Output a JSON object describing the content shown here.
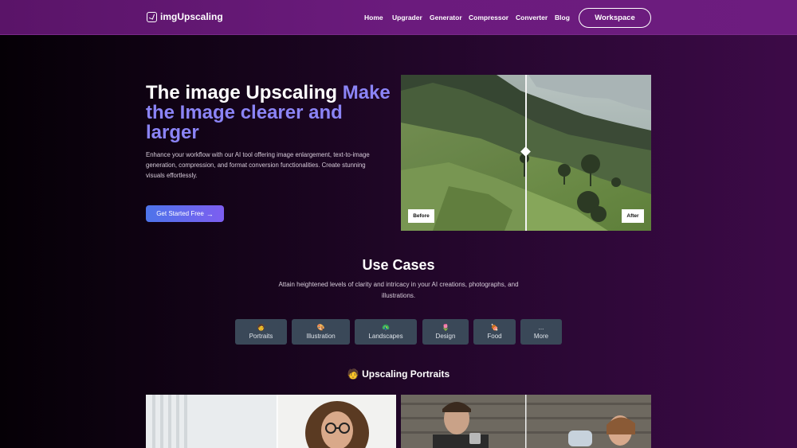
{
  "header": {
    "logo_text": "imgUpscaling",
    "nav": [
      "Home",
      "Upgrader",
      "Generator",
      "Compressor",
      "Converter",
      "Blog"
    ],
    "workspace_label": "Workspace"
  },
  "hero": {
    "title_plain": "The image Upscaling ",
    "title_accent": "Make the Image clearer and larger",
    "description": "Enhance your workflow with our AI tool offering image enlargement, text-to-image generation, compression, and format conversion functionalities. Create stunning visuals effortlessly.",
    "cta_label": "Get Started Free",
    "before_label": "Before",
    "after_label": "After"
  },
  "use_cases": {
    "title": "Use Cases",
    "description": "Attain heightened levels of clarity and intricacy in your AI creations, photographs, and illustrations.",
    "categories": [
      {
        "emoji": "🧑",
        "label": "Portraits"
      },
      {
        "emoji": "🎨",
        "label": "Illustration"
      },
      {
        "emoji": "🦚",
        "label": "Landscapes"
      },
      {
        "emoji": "🌷",
        "label": "Design"
      },
      {
        "emoji": "🍖",
        "label": "Food"
      },
      {
        "emoji": "...",
        "label": "More"
      }
    ],
    "section_heading": "🧑 Upscaling Portraits"
  },
  "colors": {
    "header_bg": "#6b1b7d",
    "accent_text": "#8b84f6",
    "cta_start": "#4d74ea",
    "cta_end": "#7d5ef0",
    "category_bg": "#3a4858"
  }
}
